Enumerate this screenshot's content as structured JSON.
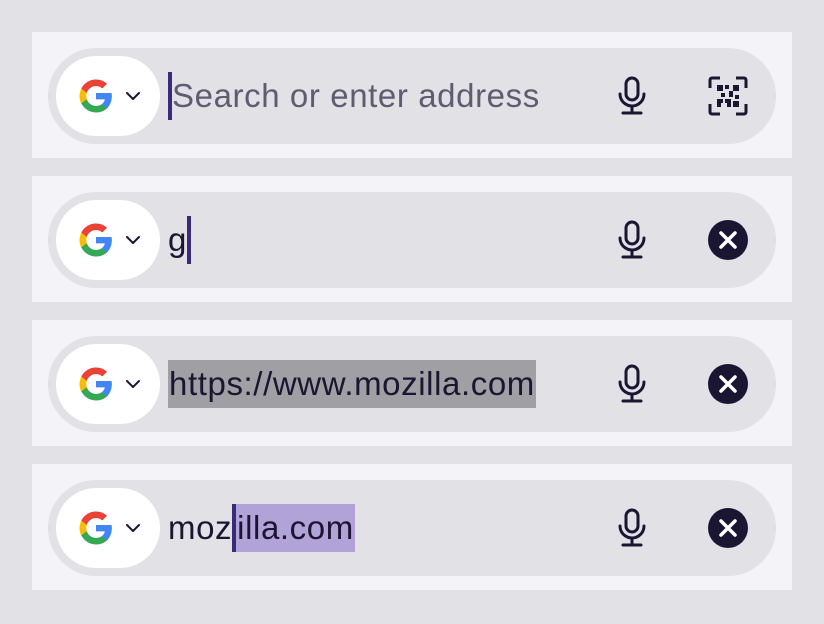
{
  "bars": [
    {
      "state": "empty",
      "placeholder": "Search or enter address",
      "typed": "",
      "selected": "",
      "right_action": "qr-scan-icon"
    },
    {
      "state": "typing",
      "placeholder": "",
      "typed": "g",
      "selected": "",
      "right_action": "clear-icon"
    },
    {
      "state": "url-selected",
      "placeholder": "",
      "typed": "",
      "selected": "https://www.mozilla.com",
      "right_action": "clear-icon"
    },
    {
      "state": "autocomplete",
      "placeholder": "",
      "typed": "moz",
      "selected": "illa.com",
      "right_action": "clear-icon"
    }
  ],
  "search_engine": {
    "icon": "google-icon",
    "dropdown_icon": "chevron-down-icon"
  },
  "colors": {
    "page_bg": "#e2e1e6",
    "card_bg": "#f4f3f8",
    "bar_bg": "#e2e1e6",
    "caret": "#3b2a7a",
    "selection_gray": "#a09fa3",
    "autocomplete_highlight": "#b1a2d7",
    "icon_dark": "#1a1530"
  }
}
